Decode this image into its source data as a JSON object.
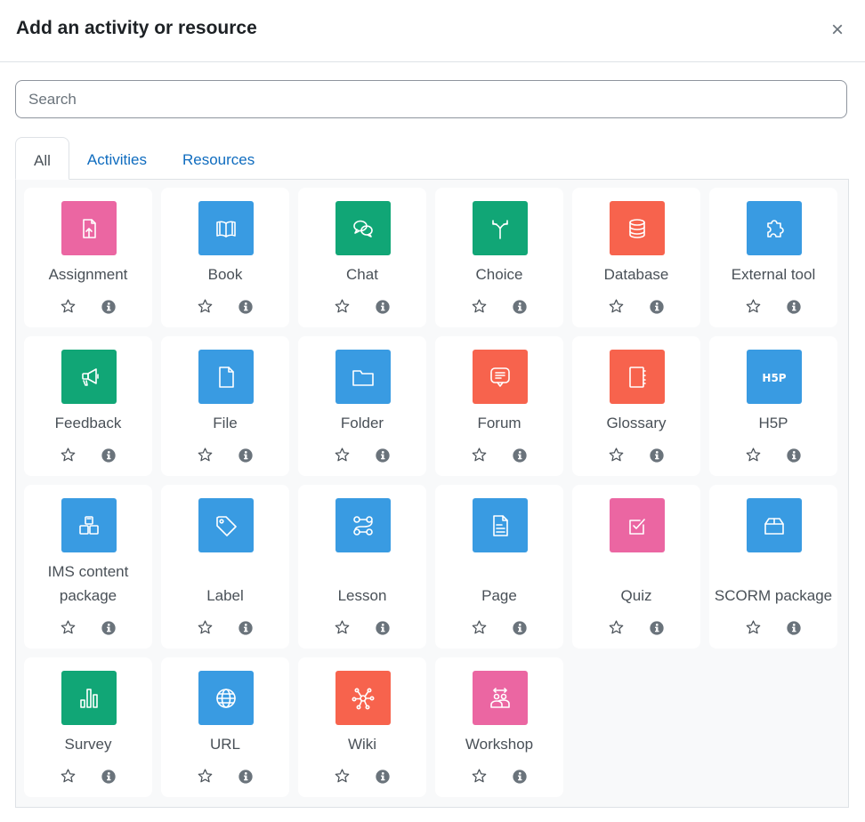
{
  "dialog": {
    "title": "Add an activity or resource",
    "close_label": "×"
  },
  "search": {
    "placeholder": "Search",
    "value": ""
  },
  "tabs": [
    {
      "label": "All",
      "active": true
    },
    {
      "label": "Activities",
      "active": false
    },
    {
      "label": "Resources",
      "active": false
    }
  ],
  "colors": {
    "assessment": "#eb66a2",
    "content": "#399be2",
    "collaboration": "#11a676",
    "communication": "#f7634d",
    "link": "#0f6cbf"
  },
  "items": [
    {
      "name": "Assignment",
      "icon": "assignment-icon",
      "color": "#eb66a2"
    },
    {
      "name": "Book",
      "icon": "book-icon",
      "color": "#399be2"
    },
    {
      "name": "Chat",
      "icon": "chat-icon",
      "color": "#11a676"
    },
    {
      "name": "Choice",
      "icon": "choice-icon",
      "color": "#11a676"
    },
    {
      "name": "Database",
      "icon": "database-icon",
      "color": "#f7634d"
    },
    {
      "name": "External tool",
      "icon": "puzzle-icon",
      "color": "#399be2"
    },
    {
      "name": "Feedback",
      "icon": "megaphone-icon",
      "color": "#11a676"
    },
    {
      "name": "File",
      "icon": "file-icon",
      "color": "#399be2"
    },
    {
      "name": "Folder",
      "icon": "folder-icon",
      "color": "#399be2"
    },
    {
      "name": "Forum",
      "icon": "forum-icon",
      "color": "#f7634d"
    },
    {
      "name": "Glossary",
      "icon": "glossary-icon",
      "color": "#f7634d"
    },
    {
      "name": "H5P",
      "icon": "h5p-icon",
      "color": "#399be2"
    },
    {
      "name": "IMS content package",
      "icon": "boxes-icon",
      "color": "#399be2"
    },
    {
      "name": "Label",
      "icon": "tag-icon",
      "color": "#399be2"
    },
    {
      "name": "Lesson",
      "icon": "path-icon",
      "color": "#399be2"
    },
    {
      "name": "Page",
      "icon": "page-icon",
      "color": "#399be2"
    },
    {
      "name": "Quiz",
      "icon": "checkbox-icon",
      "color": "#eb66a2"
    },
    {
      "name": "SCORM package",
      "icon": "package-icon",
      "color": "#399be2"
    },
    {
      "name": "Survey",
      "icon": "bar-chart-icon",
      "color": "#11a676"
    },
    {
      "name": "URL",
      "icon": "globe-icon",
      "color": "#399be2"
    },
    {
      "name": "Wiki",
      "icon": "network-icon",
      "color": "#f7634d"
    },
    {
      "name": "Workshop",
      "icon": "people-icon",
      "color": "#eb66a2"
    }
  ],
  "item_actions": {
    "star": "star-icon",
    "info": "info-icon"
  }
}
